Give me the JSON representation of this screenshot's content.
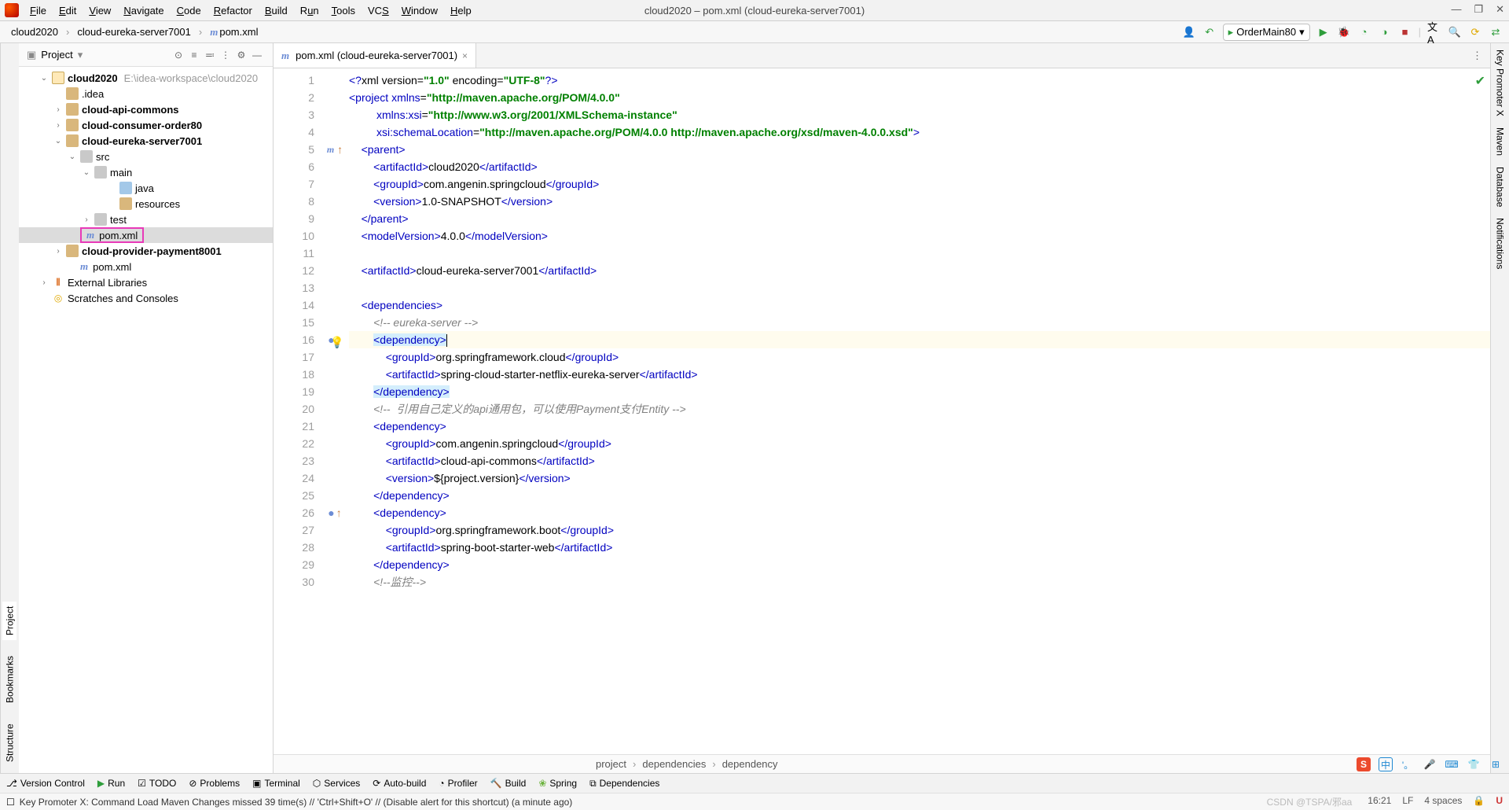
{
  "menubar": {
    "items": [
      "File",
      "Edit",
      "View",
      "Navigate",
      "Code",
      "Refactor",
      "Build",
      "Run",
      "Tools",
      "VCS",
      "Window",
      "Help"
    ]
  },
  "window_title": "cloud2020 – pom.xml (cloud-eureka-server7001)",
  "breadcrumb": {
    "a": "cloud2020",
    "b": "cloud-eureka-server7001",
    "c": "pom.xml"
  },
  "run_config": "OrderMain80",
  "project": {
    "panel_title": "Project",
    "root": {
      "name": "cloud2020",
      "sub": "E:\\idea-workspace\\cloud2020"
    },
    "nodes": [
      {
        "pad": 44,
        "arrow": "",
        "icon": "folder",
        "label": ".idea"
      },
      {
        "pad": 44,
        "arrow": "›",
        "icon": "folder",
        "label": "cloud-api-commons",
        "bold": true
      },
      {
        "pad": 44,
        "arrow": "›",
        "icon": "folder",
        "label": "cloud-consumer-order80",
        "bold": true
      },
      {
        "pad": 44,
        "arrow": "⌄",
        "icon": "folder",
        "label": "cloud-eureka-server7001",
        "bold": true
      },
      {
        "pad": 62,
        "arrow": "⌄",
        "icon": "folder-gray",
        "label": "src"
      },
      {
        "pad": 80,
        "arrow": "⌄",
        "icon": "folder-gray",
        "label": "main"
      },
      {
        "pad": 112,
        "arrow": "",
        "icon": "folder-blue",
        "label": "java"
      },
      {
        "pad": 112,
        "arrow": "",
        "icon": "folder",
        "label": "resources"
      },
      {
        "pad": 80,
        "arrow": "›",
        "icon": "folder-gray",
        "label": "test"
      },
      {
        "pad": 62,
        "arrow": "",
        "icon": "m",
        "label": "pom.xml",
        "selected": true,
        "highlighted": true
      },
      {
        "pad": 44,
        "arrow": "›",
        "icon": "folder",
        "label": "cloud-provider-payment8001",
        "bold": true
      },
      {
        "pad": 62,
        "arrow": "",
        "icon": "m",
        "label": "pom.xml"
      }
    ],
    "ext_lib": "External Libraries",
    "scratches": "Scratches and Consoles"
  },
  "editor_tab": {
    "title": "pom.xml (cloud-eureka-server7001)"
  },
  "code_lines_start": 1,
  "code_lines_end": 30,
  "breadcrumb2": {
    "a": "project",
    "b": "dependencies",
    "c": "dependency"
  },
  "bottom": {
    "vc": "Version Control",
    "run": "Run",
    "todo": "TODO",
    "problems": "Problems",
    "terminal": "Terminal",
    "services": "Services",
    "autobuild": "Auto-build",
    "profiler": "Profiler",
    "build": "Build",
    "spring": "Spring",
    "deps": "Dependencies"
  },
  "status": {
    "msg": "Key Promoter X: Command Load Maven Changes missed 39 time(s) // 'Ctrl+Shift+O' // (Disable alert for this shortcut) (a minute ago)",
    "watermark": "CSDN @TSPA/邪aa",
    "time": "16:21",
    "enc": "LF",
    "sp": "4 spaces"
  },
  "right_rail": [
    "Key Promoter X",
    "Maven",
    "Database",
    "Notifications"
  ]
}
